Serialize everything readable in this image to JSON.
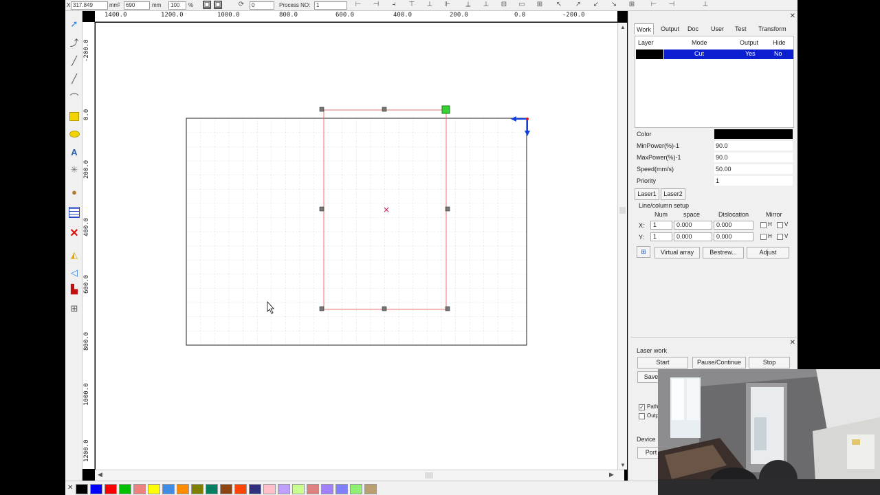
{
  "toolbar": {
    "x_value": "317.849",
    "y_value": "690",
    "size_unit_1": "mm",
    "size_unit_2": "mm",
    "scale_value": "100",
    "percent": "%",
    "rotate_value": "0",
    "process_no_label": "Process NO:",
    "process_no_value": "1"
  },
  "ruler": {
    "h_labels": [
      "1400.0",
      "1200.0",
      "1000.0",
      "800.0",
      "600.0",
      "400.0",
      "200.0",
      "0.0",
      "-200.0"
    ],
    "v_labels": [
      "-200.0",
      "0.0",
      "200.0",
      "400.0",
      "600.0",
      "800.0",
      "1000.0",
      "1200.0"
    ]
  },
  "panel": {
    "tabs": [
      "Work",
      "Output",
      "Doc",
      "User",
      "Test",
      "Transform"
    ],
    "layer_headers": [
      "Layer",
      "Mode",
      "Output",
      "Hide"
    ],
    "layer_row": {
      "mode": "Cut",
      "output": "Yes",
      "hide": "No",
      "color": "#000000"
    },
    "params": [
      {
        "label": "Color",
        "value": ""
      },
      {
        "label": "MinPower(%)-1",
        "value": "90.0"
      },
      {
        "label": "MaxPower(%)-1",
        "value": "90.0"
      },
      {
        "label": "Speed(mm/s)",
        "value": "50.00"
      },
      {
        "label": "Priority",
        "value": "1"
      }
    ],
    "laser_buttons": [
      "Laser1",
      "Laser2"
    ],
    "line_column_title": "Line/column setup",
    "array_headers": [
      "Num",
      "space",
      "Dislocation",
      "Mirror"
    ],
    "array_rows": [
      {
        "axis": "X:",
        "num": "1",
        "space": "0.000",
        "dislocation": "0.000",
        "mirror_a": "H",
        "mirror_b": "V"
      },
      {
        "axis": "Y:",
        "num": "1",
        "space": "0.000",
        "dislocation": "0.000",
        "mirror_a": "H",
        "mirror_b": "V"
      }
    ],
    "array_buttons": [
      "Virtual array",
      "Bestrew...",
      "Adjust"
    ],
    "laser_work_title": "Laser work",
    "work_buttons": [
      "Start",
      "Pause/Continue",
      "Stop"
    ],
    "save_label": "Save",
    "path_label": "Path",
    "output_label": "Outp",
    "device_label": "Device",
    "port_label": "Port"
  },
  "palette": [
    "#000000",
    "#0000ff",
    "#ff0000",
    "#00c000",
    "#f08080",
    "#ffff00",
    "#3c8ce8",
    "#ff8c00",
    "#808000",
    "#008060",
    "#8b4513",
    "#ff4500",
    "#303080",
    "#ffc0cb",
    "#c0a0ff",
    "#c8ff90",
    "#e08080",
    "#a080ff",
    "#8080ff",
    "#90ee70",
    "#b8a070"
  ]
}
